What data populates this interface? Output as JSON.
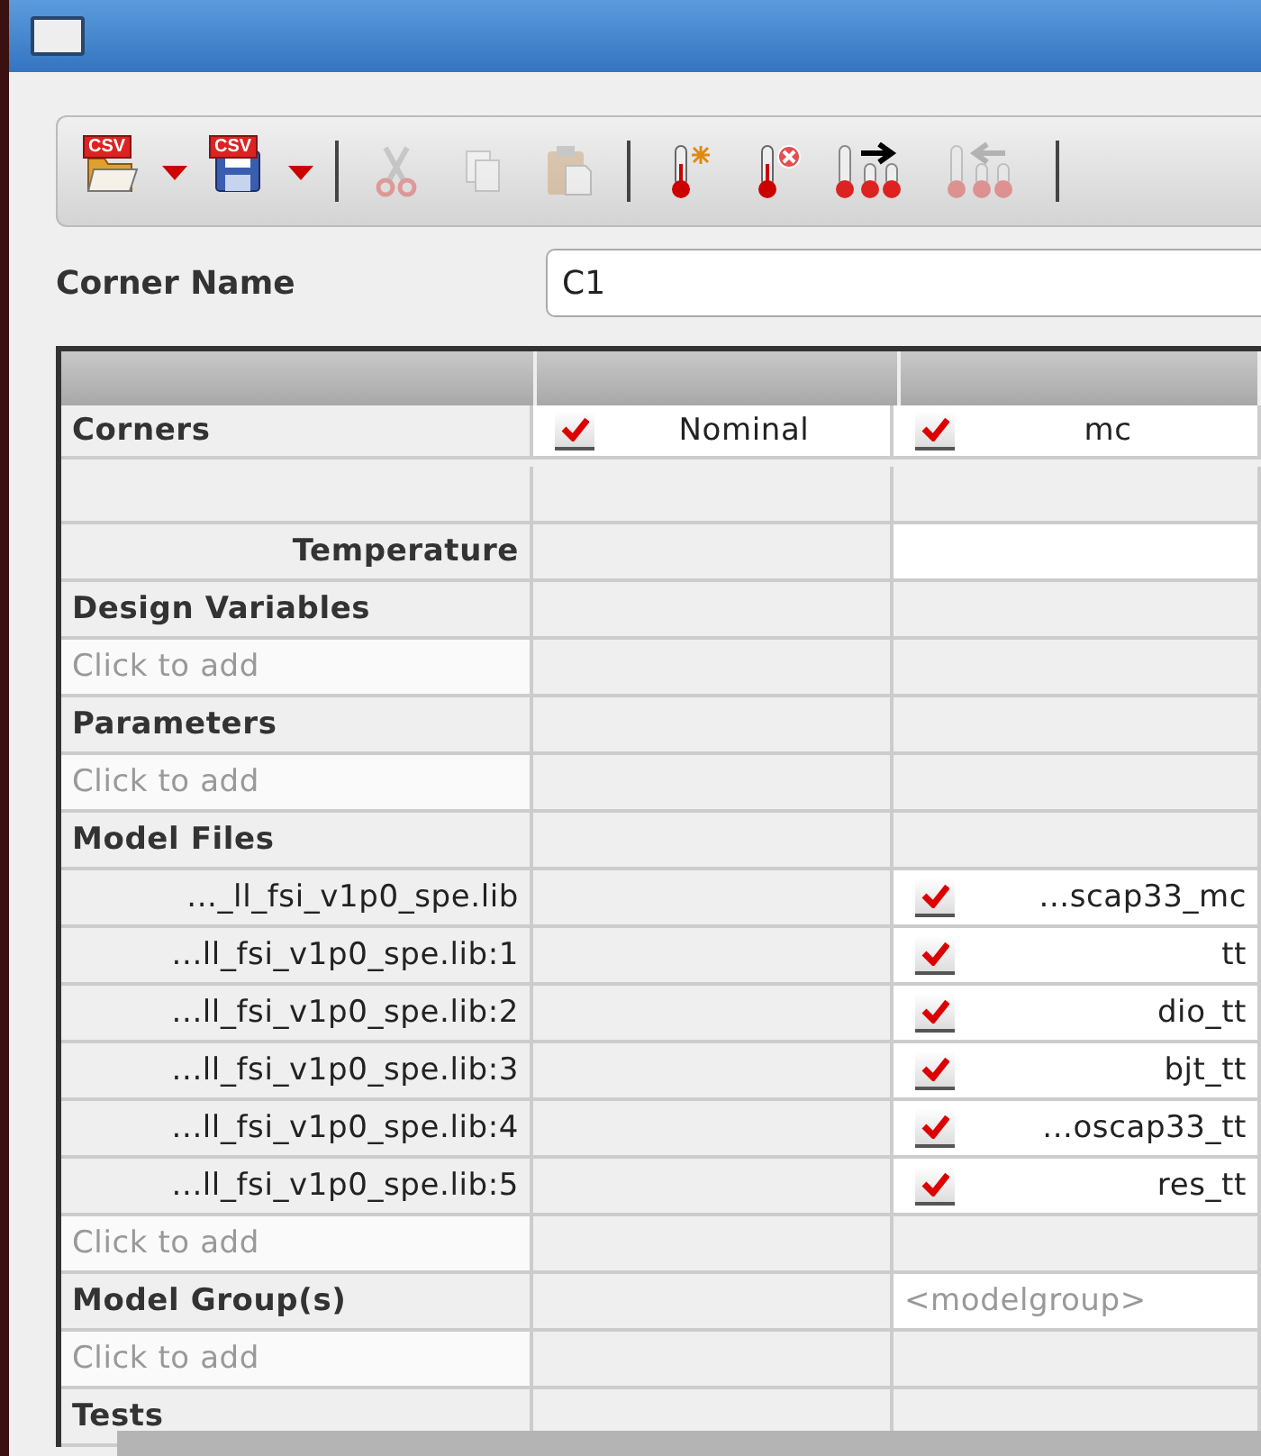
{
  "toolbar": [
    {
      "kind": "open",
      "badge": "CSV",
      "menu": true,
      "disabled": false
    },
    {
      "kind": "save",
      "badge": "CSV",
      "menu": true,
      "disabled": false
    },
    {
      "kind": "separator"
    },
    {
      "kind": "cut",
      "disabled": true
    },
    {
      "kind": "copy",
      "disabled": true
    },
    {
      "kind": "paste",
      "disabled": true
    },
    {
      "kind": "separator"
    },
    {
      "kind": "new-temp",
      "disabled": false
    },
    {
      "kind": "delete-temp",
      "disabled": false
    },
    {
      "kind": "push-temp",
      "disabled": false
    },
    {
      "kind": "pull-temp",
      "disabled": true
    },
    {
      "kind": "separator"
    }
  ],
  "corner_name": {
    "label": "Corner Name",
    "value": "C1"
  },
  "table": {
    "corners_label": "Corners",
    "columns": [
      {
        "name": "Nominal",
        "checked": true
      },
      {
        "name": "mc",
        "checked": true
      }
    ],
    "rows": [
      {
        "kind": "blank"
      },
      {
        "kind": "temperature",
        "label": "Temperature"
      },
      {
        "kind": "section",
        "label": "Design Variables"
      },
      {
        "kind": "add",
        "placeholder": "Click to add"
      },
      {
        "kind": "section",
        "label": "Parameters"
      },
      {
        "kind": "add",
        "placeholder": "Click to add"
      },
      {
        "kind": "section",
        "label": "Model Files"
      },
      {
        "kind": "model",
        "label": "..._ll_fsi_v1p0_spe.lib",
        "value": "...scap33_mc",
        "checked": true
      },
      {
        "kind": "model",
        "label": "...ll_fsi_v1p0_spe.lib:1",
        "value": "tt",
        "checked": true
      },
      {
        "kind": "model",
        "label": "...ll_fsi_v1p0_spe.lib:2",
        "value": "dio_tt",
        "checked": true
      },
      {
        "kind": "model",
        "label": "...ll_fsi_v1p0_spe.lib:3",
        "value": "bjt_tt",
        "checked": true
      },
      {
        "kind": "model",
        "label": "...ll_fsi_v1p0_spe.lib:4",
        "value": "...oscap33_tt",
        "checked": true
      },
      {
        "kind": "model",
        "label": "...ll_fsi_v1p0_spe.lib:5",
        "value": "res_tt",
        "checked": true
      },
      {
        "kind": "add",
        "placeholder": "Click to add"
      },
      {
        "kind": "group",
        "label": "Model Group(s)",
        "corner_placeholder": "<modelgroup>"
      },
      {
        "kind": "add",
        "placeholder": "Click to add"
      },
      {
        "kind": "section",
        "label": "Tests"
      }
    ]
  }
}
